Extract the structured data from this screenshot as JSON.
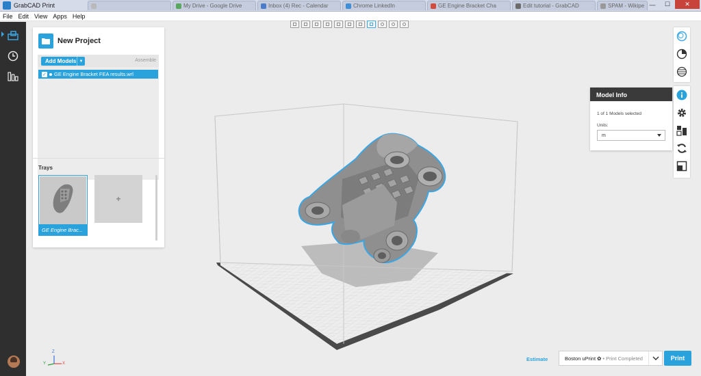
{
  "window": {
    "title": "GrabCAD Print",
    "browser_tabs": [
      {
        "label": "",
        "color": "#b9b9b9"
      },
      {
        "label": "My Drive - Google Drive",
        "color": "#5aa75f"
      },
      {
        "label": "Inbox (4) Rec - Calendar",
        "color": "#4b7cc9"
      },
      {
        "label": "Chrome LinkedIn",
        "color": "#3e8fd6"
      },
      {
        "label": "GE Engine Bracket Cha",
        "color": "#d24b3e"
      },
      {
        "label": "Edit tutorial - GrabCAD",
        "color": "#6c6c6c"
      },
      {
        "label": "SPAM - Wikipedia",
        "color": "#999999"
      }
    ],
    "controls": {
      "minimize": "—",
      "maximize": "☐",
      "close": "✕"
    }
  },
  "menu": [
    "File",
    "Edit",
    "View",
    "Apps",
    "Help"
  ],
  "sidebar": {
    "items": [
      {
        "icon": "project-icon",
        "active": true
      },
      {
        "icon": "history-clock-icon",
        "active": false
      },
      {
        "icon": "printers-bars-icon",
        "active": false
      }
    ]
  },
  "project": {
    "title": "New Project",
    "add_models_label": "Add Models",
    "assemble_label": "Assemble",
    "models": [
      {
        "name": "GE Engine Bracket FEA results.wrl",
        "checked": true
      }
    ],
    "trays_title": "Trays",
    "trays": [
      {
        "label": "GE Engine Brac..."
      }
    ],
    "add_tray_label": "+"
  },
  "viewbar": {
    "count": 11,
    "active_index": 7
  },
  "model_info": {
    "title": "Model Info",
    "selection_text": "1 of 1 Models selected",
    "units_label": "Units:",
    "units_value": "m"
  },
  "right_toolbar": {
    "top_group": [
      "view-mode-icon",
      "print-progress-icon",
      "slice-layers-icon"
    ],
    "bottom_group": [
      "info-icon",
      "settings-gear-icon",
      "arrange-icon",
      "rotate-icon",
      "scale-icon"
    ]
  },
  "footer": {
    "estimate_label": "Estimate",
    "printer_name": "Boston uPrint ✿",
    "printer_status": "• Print Completed",
    "print_label": "Print"
  },
  "axis": {
    "x": "X",
    "y": "Y",
    "z": "Z"
  },
  "colors": {
    "accent": "#2aa2dc",
    "rail": "#2f2f2f",
    "info_header": "#3a3a3a",
    "model_gray": "#8f8f8f",
    "outline": "#3aa6e3"
  }
}
